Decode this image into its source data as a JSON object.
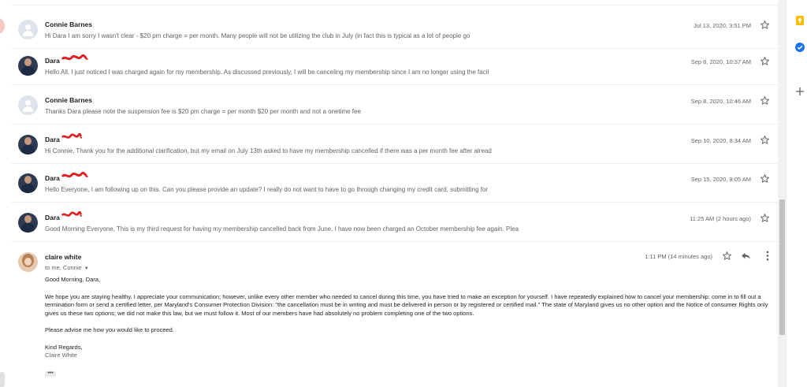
{
  "messages": [
    {
      "sender": "Connie Barnes",
      "avatar": "generic",
      "snippet": "Hi Dara I am sorry I wasn't clear - $20 pm charge = per month. Many people will not be utilizing the club in July (in fact this is typical as a lot of people go",
      "date": "Jul 13, 2020, 3:51 PM"
    },
    {
      "sender": "Dara",
      "avatar": "photo",
      "snippet": "Hello All, I just noticed I was charged again for my membership. As discussed previously, I will be canceling my membership since I am no longer using the facil",
      "date": "Sep 8, 2020, 10:37 AM"
    },
    {
      "sender": "Connie Barnes",
      "avatar": "generic",
      "snippet": "Thanks Dara please note the suspension fee is $20 pm charge = per month $20 per month and not a onetime fee",
      "date": "Sep 8, 2020, 10:46 AM"
    },
    {
      "sender": "Dara",
      "avatar": "photo",
      "snippet": "Hi Connie, Thank you for the additional clarification, but my email on July 13th asked to have my membership cancelled if there was a per month fee after alread",
      "date": "Sep 10, 2020, 8:34 AM"
    },
    {
      "sender": "Dara",
      "avatar": "photo",
      "snippet": "Hello Everyone, I am following up on this. Can you please provide an update? I really do not want to have to go through changing my credit card, submitting for",
      "date": "Sep 15, 2020, 9:05 AM"
    },
    {
      "sender": "Dara",
      "avatar": "photo",
      "snippet": "Good Morning Everyone, This is my third request for having my membership cancelled back from June. I have now been charged an October membership fee again. Plea",
      "date": "11:25 AM (2 hours ago)"
    }
  ],
  "open_message": {
    "sender": "claire white",
    "to": "to me, Connie",
    "date": "1:11 PM (14 minutes ago)",
    "body": {
      "greeting": "Good Morning, Dara,",
      "paragraph": "We hope you are staying healthy. I appreciate your communication; however, unlike every other member who needed to cancel during this time, you have tried to make an exception for yourself. I have repeatedly explained how to cancel your membership: come in to fill out a termination form or send a certified letter, per Maryland's Consumer Protection Division: \"the cancellation must be in writing and must be delivered in person or by registered or certified mail.\" The state of Maryland gives us no other option and the Notice of consumer Rights only gives us these two options; we did not make this law, but we must follow it. Most of our members have had absolutely no problem completing one of the two options.",
      "advise": "Please advise me how you would like to proceed.",
      "closing": "Kind Regards,",
      "signature": "Claire White"
    },
    "trimmed": "•••"
  },
  "icons": {
    "star": "star-outline-icon",
    "reply": "reply-icon",
    "more": "more-vert-icon",
    "side": [
      "keep-icon",
      "tasks-icon",
      "add-icon"
    ]
  },
  "colors": {
    "redaction": "#e02020",
    "keep": "#fbbc04",
    "tasks": "#1a73e8"
  }
}
